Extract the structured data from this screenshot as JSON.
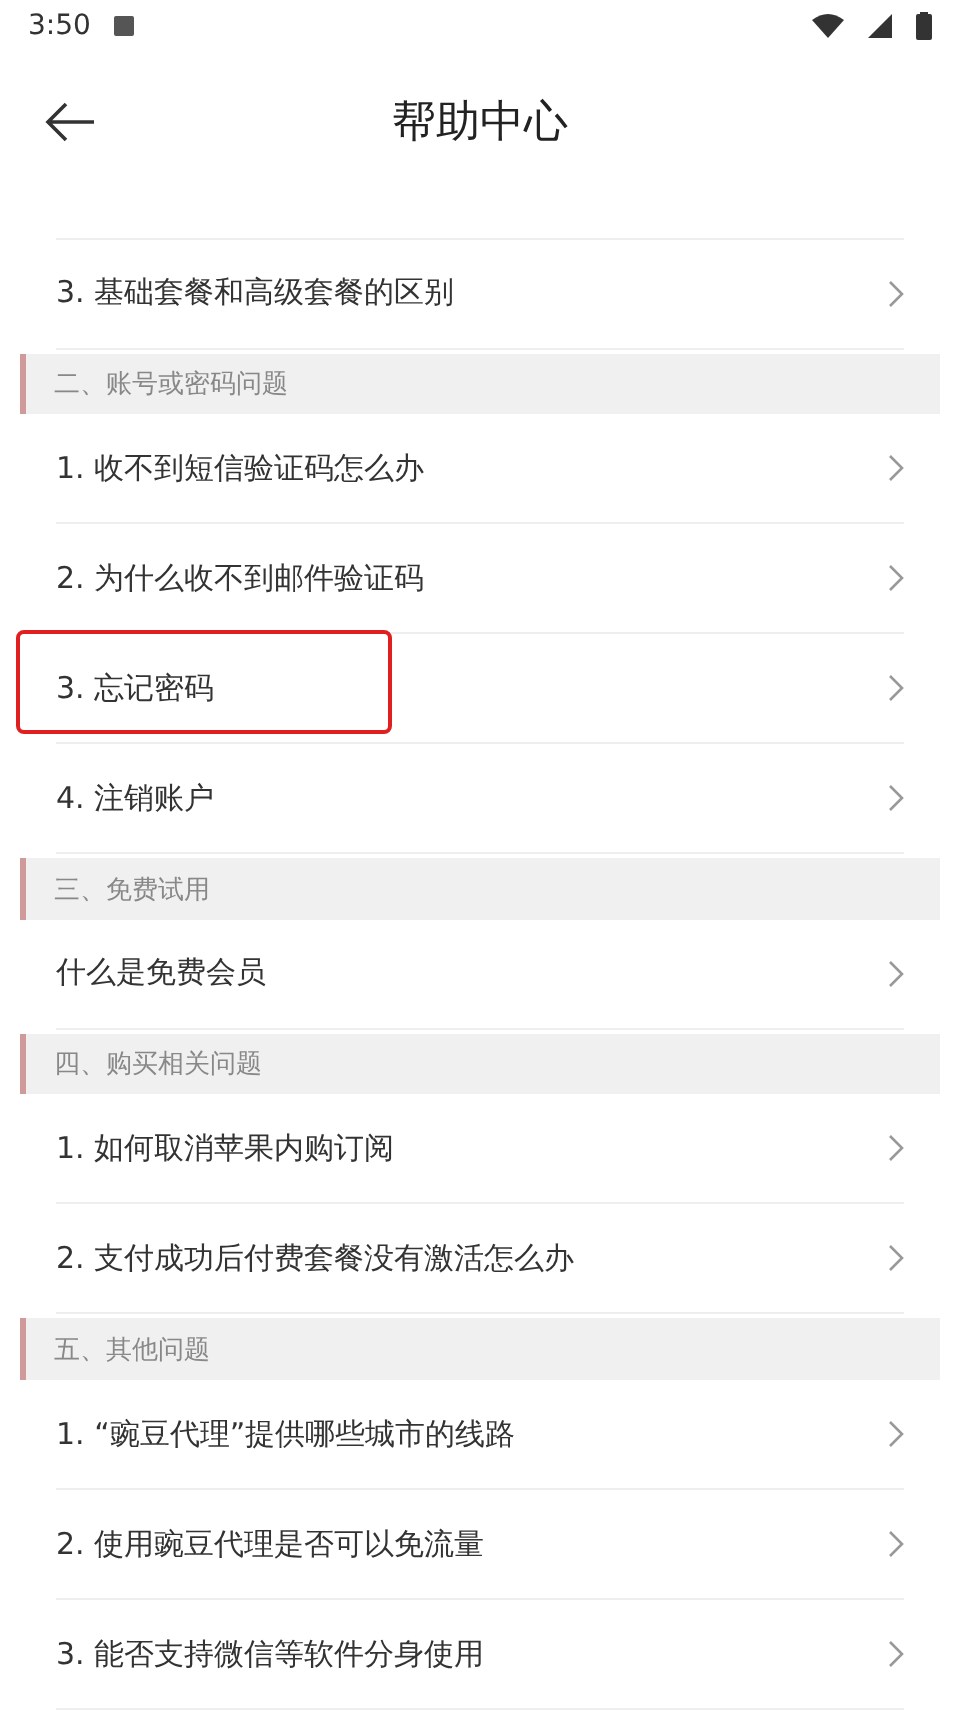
{
  "status_bar": {
    "time": "3:50"
  },
  "header": {
    "title": "帮助中心"
  },
  "sections": [
    {
      "items": [
        {
          "label": "3. 基础套餐和高级套餐的区别",
          "highlighted": false
        }
      ]
    },
    {
      "title": "二、账号或密码问题",
      "items": [
        {
          "label": "1. 收不到短信验证码怎么办",
          "highlighted": false
        },
        {
          "label": "2. 为什么收不到邮件验证码",
          "highlighted": false
        },
        {
          "label": "3. 忘记密码",
          "highlighted": true
        },
        {
          "label": "4. 注销账户",
          "highlighted": false
        }
      ]
    },
    {
      "title": "三、免费试用",
      "items": [
        {
          "label": "什么是免费会员",
          "highlighted": false
        }
      ]
    },
    {
      "title": "四、购买相关问题",
      "items": [
        {
          "label": "1. 如何取消苹果内购订阅",
          "highlighted": false
        },
        {
          "label": "2. 支付成功后付费套餐没有激活怎么办",
          "highlighted": false
        }
      ]
    },
    {
      "title": "五、其他问题",
      "items": [
        {
          "label": "1. “豌豆代理”提供哪些城市的线路",
          "highlighted": false
        },
        {
          "label": "2. 使用豌豆代理是否可以免流量",
          "highlighted": false
        },
        {
          "label": "3. 能否支持微信等软件分身使用",
          "highlighted": false
        }
      ]
    }
  ]
}
